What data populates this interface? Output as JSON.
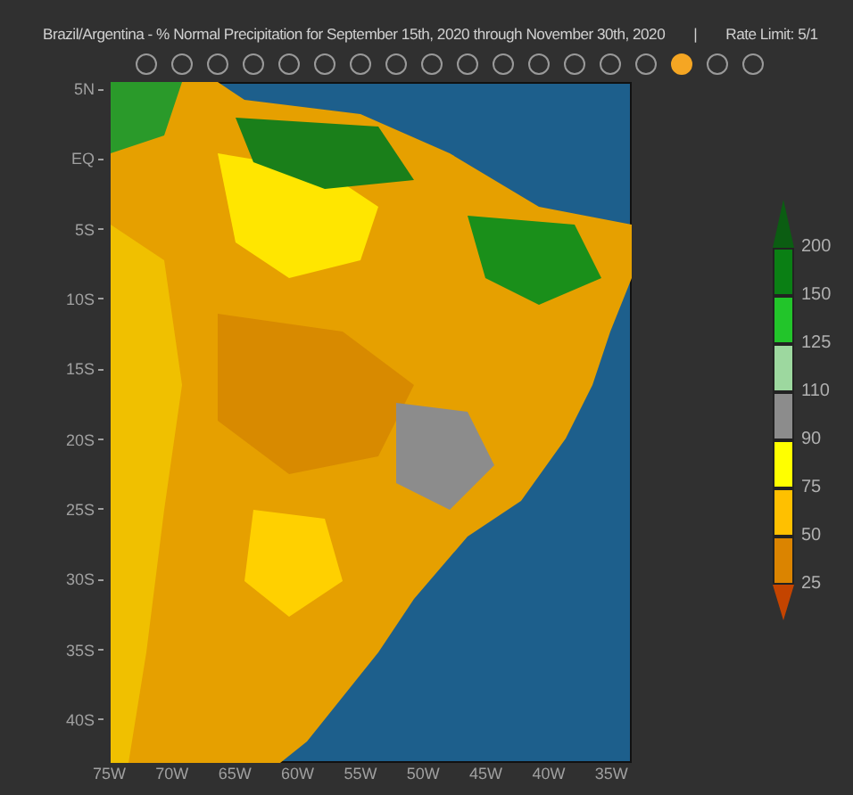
{
  "title": "Brazil/Argentina - % Normal Precipitation for September 15th, 2020 through November 30th, 2020",
  "separator": "|",
  "rate_limit": "Rate Limit: 5/1",
  "slides": [
    {
      "selected": false
    },
    {
      "selected": false
    },
    {
      "selected": false
    },
    {
      "selected": false
    },
    {
      "selected": false
    },
    {
      "selected": false
    },
    {
      "selected": false
    },
    {
      "selected": false
    },
    {
      "selected": false
    },
    {
      "selected": false
    },
    {
      "selected": false
    },
    {
      "selected": false
    },
    {
      "selected": false
    },
    {
      "selected": false
    },
    {
      "selected": false
    },
    {
      "selected": true
    },
    {
      "selected": false
    },
    {
      "selected": false
    }
  ],
  "map": {
    "y_ticks": [
      "5N",
      "EQ",
      "5S",
      "10S",
      "15S",
      "20S",
      "25S",
      "30S",
      "35S",
      "40S"
    ],
    "x_ticks": [
      "75W",
      "70W",
      "65W",
      "60W",
      "55W",
      "50W",
      "45W",
      "40W",
      "35W"
    ]
  },
  "legend": {
    "bins": [
      {
        "kind": "arrow-up",
        "color": "#0b5d12"
      },
      {
        "kind": "bin",
        "color": "#0a7f14"
      },
      {
        "kind": "bin",
        "color": "#22c52a"
      },
      {
        "kind": "bin",
        "color": "#9dd89f"
      },
      {
        "kind": "bin",
        "color": "#8c8c8c"
      },
      {
        "kind": "bin",
        "color": "#ffff00"
      },
      {
        "kind": "bin",
        "color": "#ffc000"
      },
      {
        "kind": "bin",
        "color": "#db8400"
      },
      {
        "kind": "arrow-down",
        "color": "#c44400"
      }
    ],
    "labels": [
      "200",
      "150",
      "125",
      "110",
      "90",
      "75",
      "50",
      "25"
    ]
  }
}
